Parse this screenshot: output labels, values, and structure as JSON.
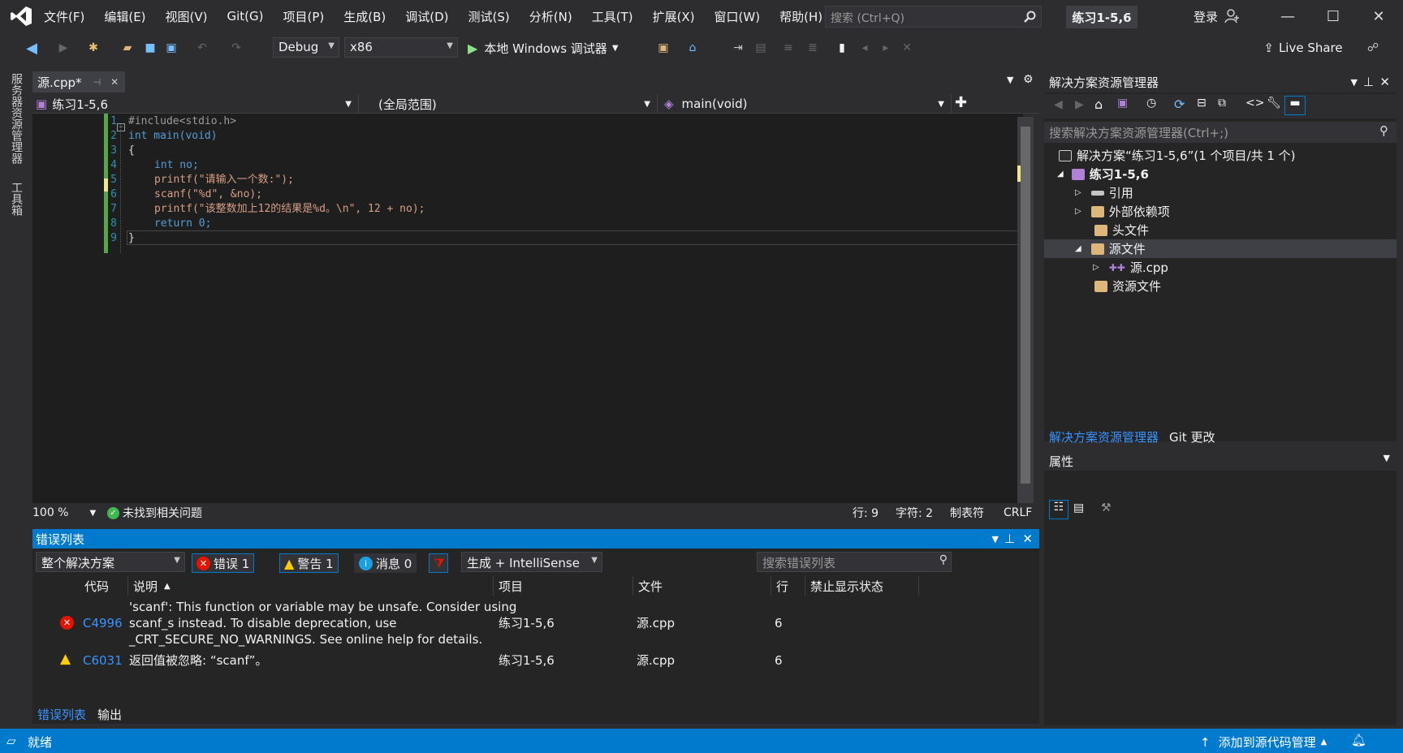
{
  "menu": {
    "items": [
      "文件(F)",
      "编辑(E)",
      "视图(V)",
      "Git(G)",
      "项目(P)",
      "生成(B)",
      "调试(D)",
      "测试(S)",
      "分析(N)",
      "工具(T)",
      "扩展(X)",
      "窗口(W)",
      "帮助(H)"
    ],
    "search_placeholder": "搜索 (Ctrl+Q)",
    "project_badge": "练习1-5,6",
    "login": "登录"
  },
  "toolbar": {
    "config": "Debug",
    "platform": "x86",
    "run_label": "本地 Windows 调试器",
    "live_share": "Live Share"
  },
  "left_rail": {
    "server_explorer": "服务器资源管理器",
    "toolbox": "工具箱"
  },
  "editor": {
    "tab": "源.cpp*",
    "nav_project": "练习1-5,6",
    "nav_scope": "(全局范围)",
    "nav_function": "main(void)",
    "lines": [
      {
        "n": "1",
        "text": "#include<stdio.h>"
      },
      {
        "n": "2",
        "text": "int main(void)"
      },
      {
        "n": "3",
        "text": "{"
      },
      {
        "n": "4",
        "text": "int no;"
      },
      {
        "n": "5",
        "text": "printf(\"请输入一个数:\");"
      },
      {
        "n": "6",
        "text": "scanf(\"%d\", &no);"
      },
      {
        "n": "7",
        "text": "printf(\"该整数加上12的结果是%d。\\n\", 12 + no);"
      },
      {
        "n": "8",
        "text": "return 0;"
      },
      {
        "n": "9",
        "text": "}"
      }
    ]
  },
  "status_line": {
    "zoom": "100 %",
    "issues": "未找到相关问题",
    "row": "行: 9",
    "col": "字符: 2",
    "tabs": "制表符",
    "eol": "CRLF"
  },
  "error_list": {
    "title": "错误列表",
    "scope": "整个解决方案",
    "errors": "错误 1",
    "warnings": "警告 1",
    "messages": "消息 0",
    "source": "生成 + IntelliSense",
    "search_placeholder": "搜索错误列表",
    "columns": [
      "代码",
      "说明",
      "项目",
      "文件",
      "行",
      "禁止显示状态"
    ],
    "rows": [
      {
        "code": "C4996",
        "desc1": "'scanf': This function or variable may be unsafe. Consider using",
        "desc2": "scanf_s instead. To disable deprecation, use",
        "desc3": "_CRT_SECURE_NO_WARNINGS. See online help for details.",
        "project": "练习1-5,6",
        "file": "源.cpp",
        "line": "6"
      },
      {
        "code": "C6031",
        "desc1": "返回值被忽略: “scanf”。",
        "project": "练习1-5,6",
        "file": "源.cpp",
        "line": "6"
      }
    ],
    "bottom_tabs": [
      "错误列表",
      "输出"
    ]
  },
  "solution_explorer": {
    "title": "解决方案资源管理器",
    "search_placeholder": "搜索解决方案资源管理器(Ctrl+;)",
    "solution": "解决方案“练习1-5,6”(1 个项目/共 1 个)",
    "project": "练习1-5,6",
    "nodes": [
      "引用",
      "外部依赖项",
      "头文件",
      "源文件",
      "源.cpp",
      "资源文件"
    ],
    "tabs": [
      "解决方案资源管理器",
      "Git 更改"
    ]
  },
  "properties": {
    "title": "属性"
  },
  "statusbar": {
    "ready": "就绪",
    "source_control": "添加到源代码管理"
  },
  "colors": {
    "accent": "#007acc",
    "keyword": "#569cd6",
    "string": "#d69d85",
    "error": "#e51400",
    "warning": "#ffcc00"
  }
}
